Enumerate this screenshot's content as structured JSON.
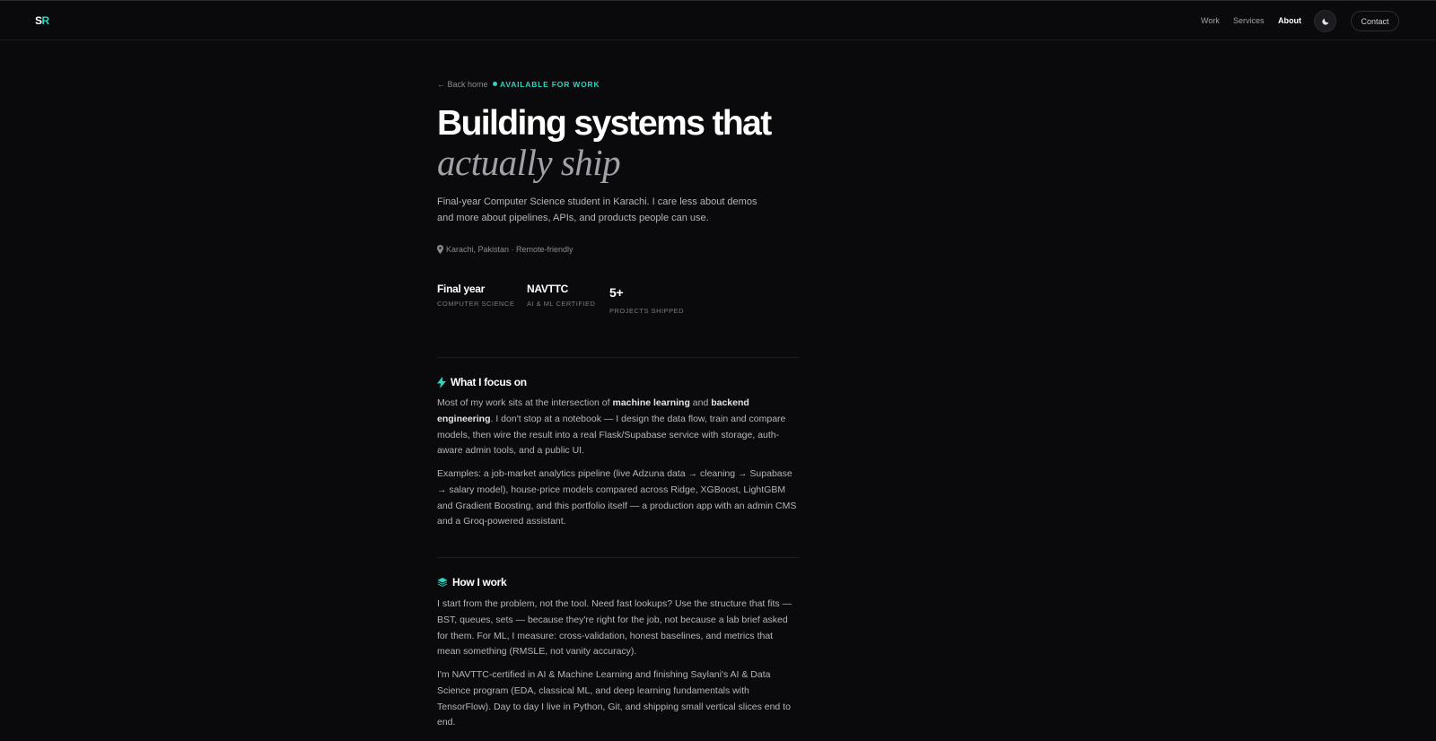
{
  "header": {
    "logo_s": "S",
    "logo_r": "R",
    "nav": [
      {
        "label": "Work"
      },
      {
        "label": "Services"
      },
      {
        "label": "About"
      }
    ],
    "contact_label": "Contact",
    "theme_icon": "moon-icon"
  },
  "hero": {
    "back_label": "← Back home",
    "status_label": "AVAILABLE FOR WORK",
    "title_line1": "Building systems that",
    "title_line2": "actually ship",
    "intro": "Final-year Computer Science student in Karachi. I care less about demos and more about pipelines, APIs, and products people can use.",
    "location": "Karachi, Pakistan · Remote-friendly"
  },
  "stats": [
    {
      "value": "Final year",
      "label": "COMPUTER SCIENCE"
    },
    {
      "value": "NAVTTC",
      "label": "AI & ML CERTIFIED"
    },
    {
      "value": "5+",
      "label": "PROJECTS SHIPPED"
    }
  ],
  "sections": {
    "focus": {
      "title": "What I focus on",
      "icon": "bolt-icon",
      "p1_a": "Most of my work sits at the intersection of ",
      "p1_b": "machine learning",
      "p1_c": " and ",
      "p1_d": "backend engineering",
      "p1_e": ". I don't stop at a notebook — I design the data flow, train and compare models, then wire the result into a real Flask/Supabase service with storage, auth-aware admin tools, and a public UI.",
      "p2": "Examples: a job-market analytics pipeline (live Adzuna data → cleaning → Supabase → salary model), house-price models compared across Ridge, XGBoost, LightGBM and Gradient Boosting, and this portfolio itself — a production app with an admin CMS and a Groq-powered assistant."
    },
    "how": {
      "title": "How I work",
      "icon": "layers-icon",
      "p1": "I start from the problem, not the tool. Need fast lookups? Use the structure that fits — BST, queues, sets — because they're right for the job, not because a lab brief asked for them. For ML, I measure: cross-validation, honest baselines, and metrics that mean something (RMSLE, not vanity accuracy).",
      "p2": "I'm NAVTTC-certified in AI & Machine Learning and finishing Saylani's AI & Data Science program (EDA, classical ML, and deep learning fundamentals with TensorFlow). Day to day I live in Python, Git, and shipping small vertical slices end to end."
    }
  },
  "colors": {
    "accent": "#2dd4bf",
    "background": "#0a0a0c"
  }
}
